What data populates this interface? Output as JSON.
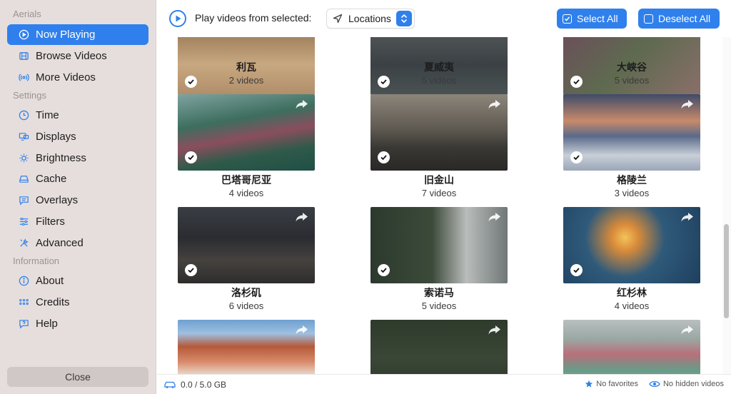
{
  "sidebar": {
    "sections": [
      {
        "title": "Aerials"
      },
      {
        "title": "Settings"
      },
      {
        "title": "Information"
      }
    ],
    "items": [
      {
        "label": "Now Playing",
        "icon": "play-circle-icon",
        "active": true
      },
      {
        "label": "Browse Videos",
        "icon": "film-icon"
      },
      {
        "label": "More Videos",
        "icon": "broadcast-icon"
      },
      {
        "label": "Time",
        "icon": "clock-icon"
      },
      {
        "label": "Displays",
        "icon": "displays-icon"
      },
      {
        "label": "Brightness",
        "icon": "sun-icon"
      },
      {
        "label": "Cache",
        "icon": "drive-icon"
      },
      {
        "label": "Overlays",
        "icon": "text-bubble-icon"
      },
      {
        "label": "Filters",
        "icon": "sliders-icon"
      },
      {
        "label": "Advanced",
        "icon": "tools-icon"
      },
      {
        "label": "About",
        "icon": "info-icon"
      },
      {
        "label": "Credits",
        "icon": "people-icon"
      },
      {
        "label": "Help",
        "icon": "help-bubble-icon"
      }
    ],
    "close_label": "Close"
  },
  "toolbar": {
    "play_label": "Play videos from selected:",
    "source_select": "Locations",
    "select_all": "Select All",
    "deselect_all": "Deselect All"
  },
  "locations": [
    {
      "name": "利瓦",
      "count": "2 videos"
    },
    {
      "name": "夏威夷",
      "count": "5 videos"
    },
    {
      "name": "大峡谷",
      "count": "5 videos"
    },
    {
      "name": "巴塔哥尼亚",
      "count": "4 videos"
    },
    {
      "name": "旧金山",
      "count": "7 videos"
    },
    {
      "name": "格陵兰",
      "count": "3 videos"
    },
    {
      "name": "洛杉矶",
      "count": "6 videos"
    },
    {
      "name": "索诺马",
      "count": "5 videos"
    },
    {
      "name": "红杉林",
      "count": "4 videos"
    }
  ],
  "statusbar": {
    "storage": "0.0 / 5.0 GB",
    "favorites": "No favorites",
    "hidden": "No hidden videos"
  },
  "colors": {
    "accent": "#2f80ed",
    "sidebar_bg": "#e6dedc"
  }
}
